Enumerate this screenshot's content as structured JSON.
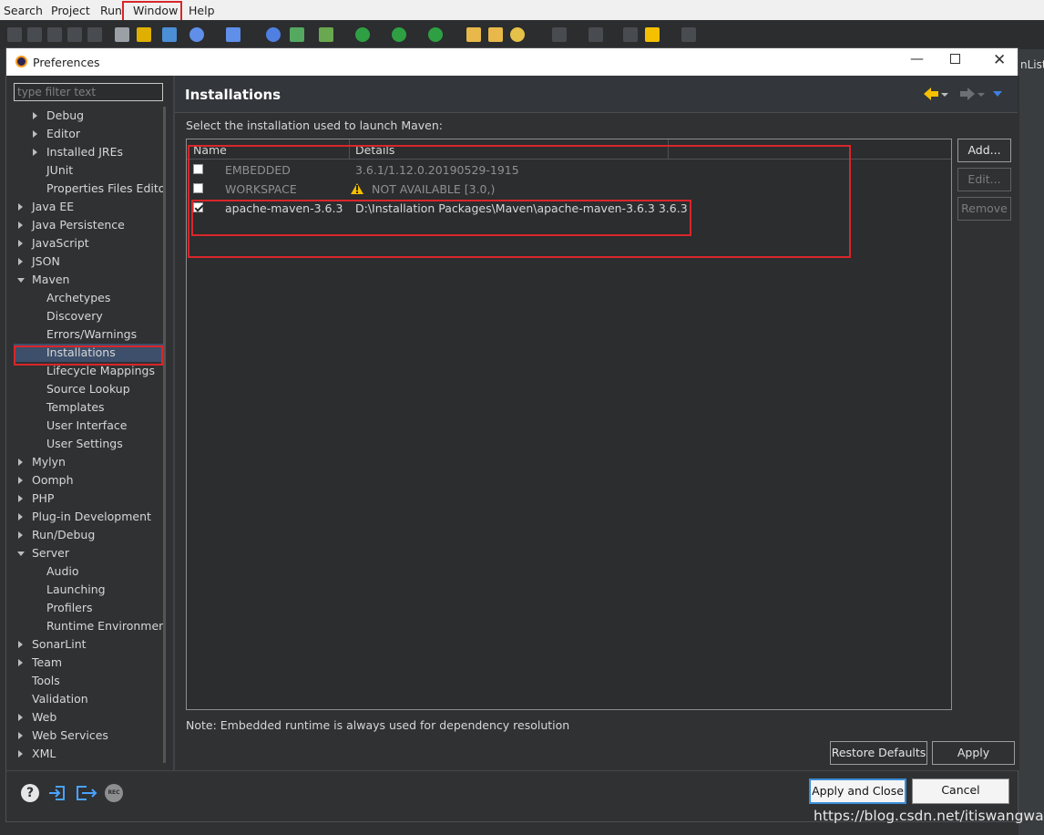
{
  "menubar": {
    "items": [
      "Search",
      "Project",
      "Run",
      "Window",
      "Help"
    ]
  },
  "background_right_text": "nList,",
  "dialog": {
    "title": "Preferences",
    "filter_placeholder": "type filter text",
    "tree": [
      {
        "label": "Debug",
        "indent": 1,
        "arrow": "right"
      },
      {
        "label": "Editor",
        "indent": 1,
        "arrow": "right"
      },
      {
        "label": "Installed JREs",
        "indent": 1,
        "arrow": "right"
      },
      {
        "label": "JUnit",
        "indent": 1,
        "arrow": "none"
      },
      {
        "label": "Properties Files Edito",
        "indent": 1,
        "arrow": "none"
      },
      {
        "label": "Java EE",
        "indent": 0,
        "arrow": "right"
      },
      {
        "label": "Java Persistence",
        "indent": 0,
        "arrow": "right"
      },
      {
        "label": "JavaScript",
        "indent": 0,
        "arrow": "right"
      },
      {
        "label": "JSON",
        "indent": 0,
        "arrow": "right"
      },
      {
        "label": "Maven",
        "indent": 0,
        "arrow": "down"
      },
      {
        "label": "Archetypes",
        "indent": 1,
        "arrow": "none"
      },
      {
        "label": "Discovery",
        "indent": 1,
        "arrow": "none"
      },
      {
        "label": "Errors/Warnings",
        "indent": 1,
        "arrow": "none"
      },
      {
        "label": "Installations",
        "indent": 1,
        "arrow": "none",
        "selected": true
      },
      {
        "label": "Lifecycle Mappings",
        "indent": 1,
        "arrow": "none"
      },
      {
        "label": "Source Lookup",
        "indent": 1,
        "arrow": "none"
      },
      {
        "label": "Templates",
        "indent": 1,
        "arrow": "none"
      },
      {
        "label": "User Interface",
        "indent": 1,
        "arrow": "none"
      },
      {
        "label": "User Settings",
        "indent": 1,
        "arrow": "none"
      },
      {
        "label": "Mylyn",
        "indent": 0,
        "arrow": "right"
      },
      {
        "label": "Oomph",
        "indent": 0,
        "arrow": "right"
      },
      {
        "label": "PHP",
        "indent": 0,
        "arrow": "right"
      },
      {
        "label": "Plug-in Development",
        "indent": 0,
        "arrow": "right"
      },
      {
        "label": "Run/Debug",
        "indent": 0,
        "arrow": "right"
      },
      {
        "label": "Server",
        "indent": 0,
        "arrow": "down"
      },
      {
        "label": "Audio",
        "indent": 1,
        "arrow": "none"
      },
      {
        "label": "Launching",
        "indent": 1,
        "arrow": "none"
      },
      {
        "label": "Profilers",
        "indent": 1,
        "arrow": "none"
      },
      {
        "label": "Runtime Environment",
        "indent": 1,
        "arrow": "none"
      },
      {
        "label": "SonarLint",
        "indent": 0,
        "arrow": "right"
      },
      {
        "label": "Team",
        "indent": 0,
        "arrow": "right"
      },
      {
        "label": "Tools",
        "indent": 0,
        "arrow": "none"
      },
      {
        "label": "Validation",
        "indent": 0,
        "arrow": "none"
      },
      {
        "label": "Web",
        "indent": 0,
        "arrow": "right"
      },
      {
        "label": "Web Services",
        "indent": 0,
        "arrow": "right"
      },
      {
        "label": "XML",
        "indent": 0,
        "arrow": "right"
      }
    ],
    "page": {
      "title": "Installations",
      "description": "Select the installation used to launch Maven:",
      "columns": [
        "Name",
        "Details"
      ],
      "rows": [
        {
          "checked": false,
          "name": "EMBEDDED",
          "details": "3.6.1/1.12.0.20190529-1915",
          "dimmed": true,
          "warning": false
        },
        {
          "checked": false,
          "name": "WORKSPACE",
          "details": "NOT AVAILABLE [3.0,)",
          "dimmed": true,
          "warning": true
        },
        {
          "checked": true,
          "name": "apache-maven-3.6.3",
          "details": "D:\\Installation Packages\\Maven\\apache-maven-3.6.3 3.6.3",
          "dimmed": false,
          "warning": false
        }
      ],
      "side_buttons": {
        "add": "Add...",
        "edit": "Edit...",
        "remove": "Remove"
      },
      "note": "Note: Embedded runtime is always used for dependency resolution",
      "restore_defaults": "Restore Defaults",
      "apply": "Apply"
    },
    "apply_and_close": "Apply and Close",
    "cancel": "Cancel"
  },
  "watermark": "https://blog.csdn.net/itiswangwang",
  "colors": {
    "highlight_box": "#d9262a",
    "nav_arrow": "#f5c000",
    "selection": "#3d4f6b"
  }
}
